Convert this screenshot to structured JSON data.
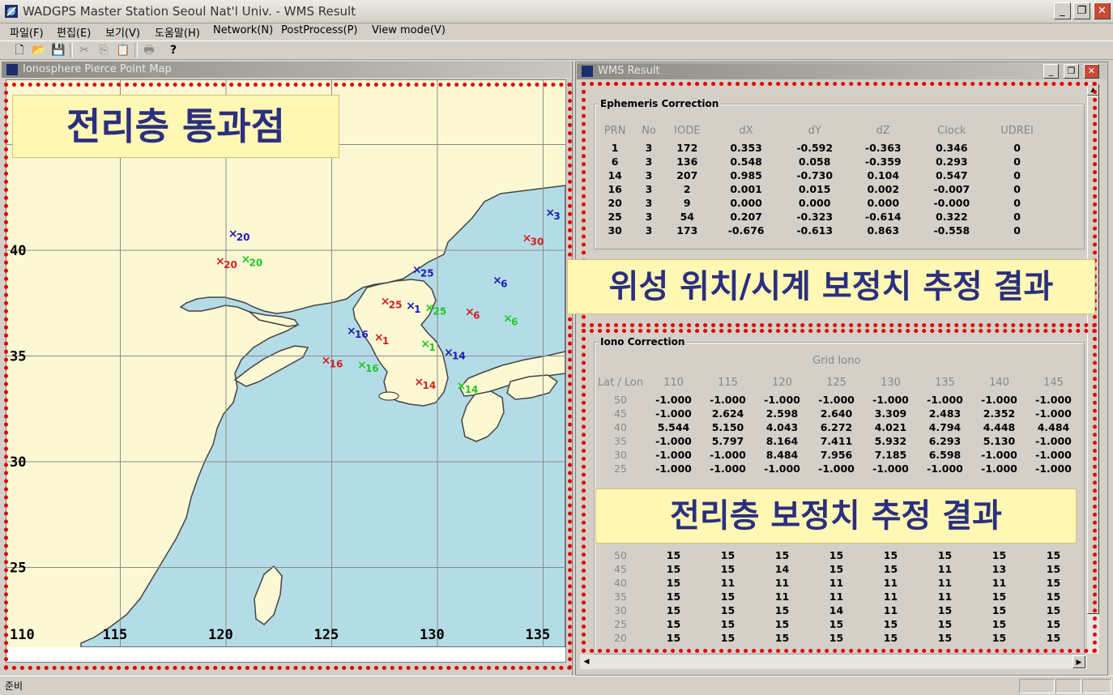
{
  "app": {
    "title": "WADGPS Master Station Seoul Nat'l Univ. - WMS Result",
    "minimize": "_",
    "restore": "❐",
    "close": "✕"
  },
  "menu": [
    "파일(F)",
    "편집(E)",
    "보기(V)",
    "도움말(H)",
    "Network(N)",
    "PostProcess(P)",
    "View mode(V)"
  ],
  "toolbar": {
    "icons": [
      "new-file-icon",
      "open-folder-icon",
      "save-icon",
      "cut-icon",
      "copy-icon",
      "paste-icon",
      "print-icon",
      "help-icon"
    ]
  },
  "map_window": {
    "title": "Ionosphere Pierce Point Map",
    "callout": "전리층 통과점",
    "lat_labels": [
      "40",
      "35",
      "30",
      "25"
    ],
    "lon_labels": [
      "110",
      "115",
      "120",
      "125",
      "130",
      "135"
    ],
    "colors": {
      "sea": "#b4dce6",
      "land": "#fcf8d4",
      "grid": "#8a8a8a",
      "red": "#d42020",
      "blue": "#1c1cb4",
      "green": "#20c820"
    },
    "markers": [
      {
        "label": "20",
        "color": "blue",
        "lon": 120.3,
        "lat": 40.8
      },
      {
        "label": "20",
        "color": "red",
        "lon": 119.7,
        "lat": 39.5
      },
      {
        "label": "20",
        "color": "green",
        "lon": 120.9,
        "lat": 39.6
      },
      {
        "label": "25",
        "color": "blue",
        "lon": 129.0,
        "lat": 39.1
      },
      {
        "label": "6",
        "color": "blue",
        "lon": 132.8,
        "lat": 38.6
      },
      {
        "label": "30",
        "color": "red",
        "lon": 134.2,
        "lat": 40.6
      },
      {
        "label": "3",
        "color": "blue",
        "lon": 135.3,
        "lat": 41.8
      },
      {
        "label": "25",
        "color": "red",
        "lon": 127.5,
        "lat": 37.6
      },
      {
        "label": "1",
        "color": "blue",
        "lon": 128.7,
        "lat": 37.4
      },
      {
        "label": "25",
        "color": "green",
        "lon": 129.6,
        "lat": 37.3
      },
      {
        "label": "6",
        "color": "red",
        "lon": 131.5,
        "lat": 37.1
      },
      {
        "label": "6",
        "color": "green",
        "lon": 133.3,
        "lat": 36.8
      },
      {
        "label": "16",
        "color": "blue",
        "lon": 125.9,
        "lat": 36.2
      },
      {
        "label": "1",
        "color": "red",
        "lon": 127.2,
        "lat": 35.9
      },
      {
        "label": "1",
        "color": "green",
        "lon": 129.4,
        "lat": 35.6
      },
      {
        "label": "14",
        "color": "blue",
        "lon": 130.5,
        "lat": 35.2
      },
      {
        "label": "16",
        "color": "red",
        "lon": 124.7,
        "lat": 34.8
      },
      {
        "label": "16",
        "color": "green",
        "lon": 126.4,
        "lat": 34.6
      },
      {
        "label": "14",
        "color": "red",
        "lon": 129.1,
        "lat": 33.8
      },
      {
        "label": "14",
        "color": "green",
        "lon": 131.1,
        "lat": 33.6
      }
    ]
  },
  "wms_window": {
    "title": "WMS Result",
    "ephemeris": {
      "label": "Ephemeris Correction",
      "headers": [
        "PRN",
        "No",
        "IODE",
        "dX",
        "dY",
        "dZ",
        "Clock",
        "UDREI"
      ],
      "rows": [
        [
          "1",
          "3",
          "172",
          "0.353",
          "-0.592",
          "-0.363",
          "0.346",
          "0"
        ],
        [
          "6",
          "3",
          "136",
          "0.548",
          "0.058",
          "-0.359",
          "0.293",
          "0"
        ],
        [
          "14",
          "3",
          "207",
          "0.985",
          "-0.730",
          "0.104",
          "0.547",
          "0"
        ],
        [
          "16",
          "3",
          "2",
          "0.001",
          "0.015",
          "0.002",
          "-0.007",
          "0"
        ],
        [
          "20",
          "3",
          "9",
          "0.000",
          "0.000",
          "0.000",
          "-0.000",
          "0"
        ],
        [
          "25",
          "3",
          "54",
          "0.207",
          "-0.323",
          "-0.614",
          "0.322",
          "0"
        ],
        [
          "30",
          "3",
          "173",
          "-0.676",
          "-0.613",
          "0.863",
          "-0.558",
          "0"
        ]
      ]
    },
    "callout_ephemeris": "위성 위치/시계 보정치 추정 결과",
    "iono": {
      "label": "Iono Correction",
      "grid_label": "Grid Iono",
      "corner": "Lat / Lon",
      "lons": [
        "110",
        "115",
        "120",
        "125",
        "130",
        "135",
        "140",
        "145"
      ],
      "delay_rows": [
        {
          "lat": "50",
          "v": [
            "-1.000",
            "-1.000",
            "-1.000",
            "-1.000",
            "-1.000",
            "-1.000",
            "-1.000",
            "-1.000"
          ]
        },
        {
          "lat": "45",
          "v": [
            "-1.000",
            "2.624",
            "2.598",
            "2.640",
            "3.309",
            "2.483",
            "2.352",
            "-1.000"
          ]
        },
        {
          "lat": "40",
          "v": [
            "5.544",
            "5.150",
            "4.043",
            "6.272",
            "4.021",
            "4.794",
            "4.448",
            "4.484"
          ]
        },
        {
          "lat": "35",
          "v": [
            "-1.000",
            "5.797",
            "8.164",
            "7.411",
            "5.932",
            "6.293",
            "5.130",
            "-1.000"
          ]
        },
        {
          "lat": "30",
          "v": [
            "-1.000",
            "-1.000",
            "8.484",
            "7.956",
            "7.185",
            "6.598",
            "-1.000",
            "-1.000"
          ]
        },
        {
          "lat": "25",
          "v": [
            "-1.000",
            "-1.000",
            "-1.000",
            "-1.000",
            "-1.000",
            "-1.000",
            "-1.000",
            "-1.000"
          ]
        }
      ],
      "give_rows": [
        {
          "lat": "50",
          "v": [
            "15",
            "15",
            "15",
            "15",
            "15",
            "15",
            "15",
            "15"
          ]
        },
        {
          "lat": "45",
          "v": [
            "15",
            "15",
            "14",
            "15",
            "15",
            "11",
            "13",
            "15"
          ]
        },
        {
          "lat": "40",
          "v": [
            "15",
            "11",
            "11",
            "11",
            "11",
            "11",
            "11",
            "15"
          ]
        },
        {
          "lat": "35",
          "v": [
            "15",
            "15",
            "11",
            "11",
            "11",
            "11",
            "15",
            "15"
          ]
        },
        {
          "lat": "30",
          "v": [
            "15",
            "15",
            "15",
            "14",
            "11",
            "15",
            "15",
            "15"
          ]
        },
        {
          "lat": "25",
          "v": [
            "15",
            "15",
            "15",
            "15",
            "15",
            "15",
            "15",
            "15"
          ]
        },
        {
          "lat": "20",
          "v": [
            "15",
            "15",
            "15",
            "15",
            "15",
            "15",
            "15",
            "15"
          ]
        }
      ]
    },
    "callout_iono": "전리층 보정치 추정 결과"
  },
  "status": {
    "text": "준비"
  }
}
